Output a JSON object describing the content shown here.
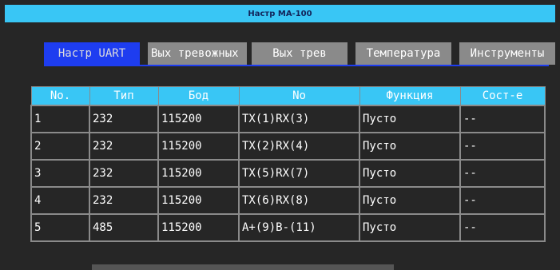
{
  "window": {
    "title": "Настр МА-100"
  },
  "tabs": [
    {
      "label": "Настр UART",
      "active": true
    },
    {
      "label": "Вых тревожных",
      "active": false
    },
    {
      "label": "Вых трев",
      "active": false
    },
    {
      "label": "Температура",
      "active": false
    },
    {
      "label": "Инструменты",
      "active": false
    }
  ],
  "table": {
    "columns": [
      "No.",
      "Тип",
      "Бод",
      "No",
      "Функция",
      "Сост-е"
    ],
    "rows": [
      [
        "1",
        "232",
        "115200",
        "TX(1)RX(3)",
        "Пусто",
        "--"
      ],
      [
        "2",
        "232",
        "115200",
        "TX(2)RX(4)",
        "Пусто",
        "--"
      ],
      [
        "3",
        "232",
        "115200",
        "TX(5)RX(7)",
        "Пусто",
        "--"
      ],
      [
        "4",
        "232",
        "115200",
        "TX(6)RX(8)",
        "Пусто",
        "--"
      ],
      [
        "5",
        "485",
        "115200",
        "A+(9)B-(11)",
        "Пусто",
        "--"
      ]
    ]
  },
  "colors": {
    "accent": "#39c6f5",
    "active_tab": "#1e3df0",
    "background": "#262626",
    "grid": "#8a8a8a"
  }
}
